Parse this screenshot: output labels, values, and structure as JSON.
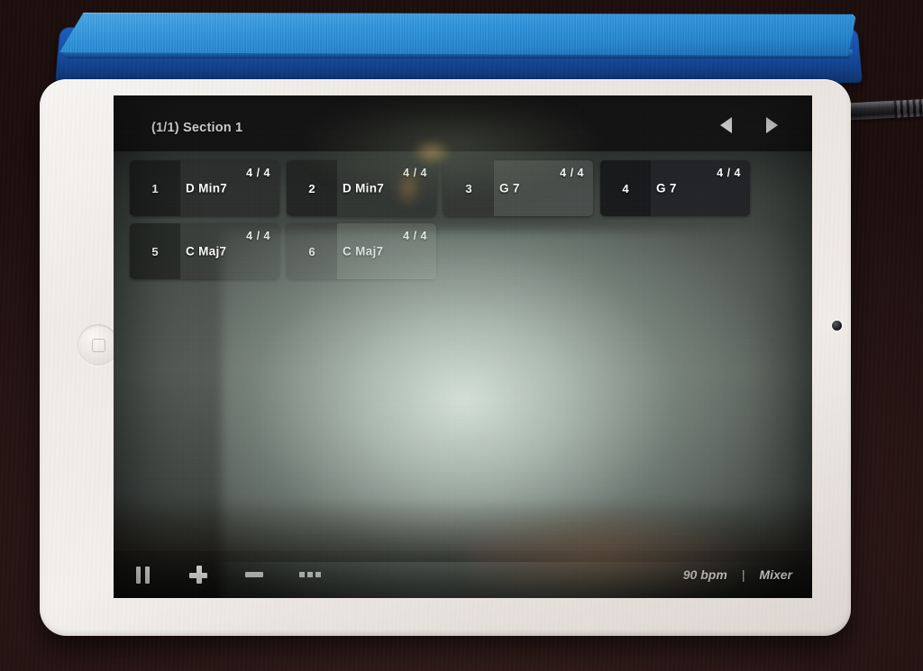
{
  "device": {
    "name": "iPad mini (white)",
    "cover_color": "#2f95de",
    "body_color": "#f0ebe7",
    "home_button": "home-button",
    "camera": "front-camera",
    "cable": "headphone-cable"
  },
  "app": {
    "topbar": {
      "title": "(1/1) Section 1",
      "prev_label": "◀",
      "next_label": "▶"
    },
    "chart": {
      "columns_per_row": 4,
      "cells": [
        {
          "number": "1",
          "chord": "D Min7",
          "time_signature": "4 / 4"
        },
        {
          "number": "2",
          "chord": "D Min7",
          "time_signature": "4 / 4"
        },
        {
          "number": "3",
          "chord": "G 7",
          "time_signature": "4 / 4"
        },
        {
          "number": "4",
          "chord": "G 7",
          "time_signature": "4 / 4"
        },
        {
          "number": "5",
          "chord": "C Maj7",
          "time_signature": "4 / 4"
        },
        {
          "number": "6",
          "chord": "C Maj7",
          "time_signature": "4 / 4"
        }
      ]
    },
    "bottombar": {
      "pause_label": "pause",
      "add_label": "add",
      "remove_label": "remove",
      "more_label": "more",
      "tempo": "90 bpm",
      "separator": "|",
      "mixer": "Mixer"
    }
  },
  "colors": {
    "screen_bg": "#0e0e0e",
    "cell_bg": "#2e302f",
    "text": "#ffffff",
    "glare": "#e1eee4",
    "desk": "#2a1715"
  }
}
